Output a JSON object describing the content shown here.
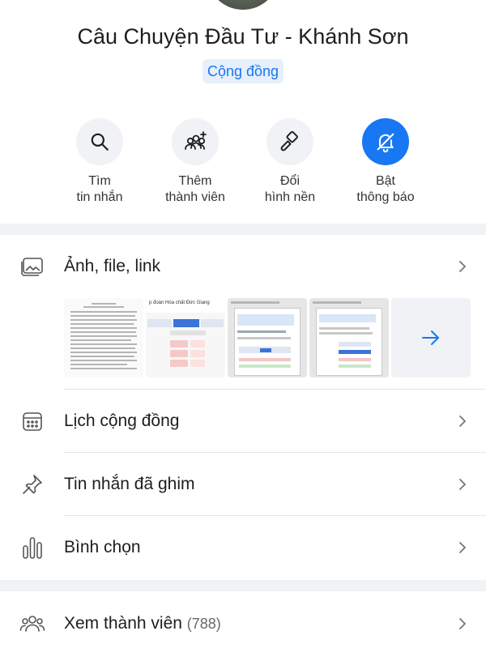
{
  "header": {
    "group_name": "Câu Chuyện Đầu Tư - Khánh Sơn",
    "badge": "Cộng đồng"
  },
  "actions": [
    {
      "line1": "Tìm",
      "line2": "tin nhắn",
      "icon": "search-icon"
    },
    {
      "line1": "Thêm",
      "line2": "thành viên",
      "icon": "add-people-icon"
    },
    {
      "line1": "Đổi",
      "line2": "hình nền",
      "icon": "paint-brush-icon"
    },
    {
      "line1": "Bật",
      "line2": "thông báo",
      "icon": "bell-off-icon",
      "active": true
    }
  ],
  "media": {
    "label": "Ảnh, file, link",
    "thumb_titles": [
      "p đoàn Hóa chất Đức Giang"
    ]
  },
  "menu": {
    "calendar_label": "Lịch cộng đồng",
    "pinned_label": "Tin nhắn đã ghim",
    "poll_label": "Bình chọn",
    "members_label": "Xem thành viên",
    "members_count": "(788)"
  },
  "colors": {
    "accent": "#1877f2",
    "band": "#f0f2f5"
  }
}
